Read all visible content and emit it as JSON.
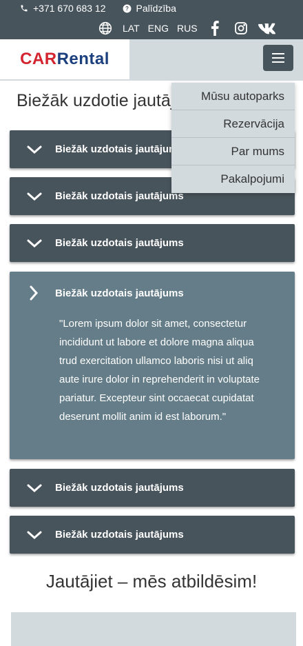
{
  "topbar": {
    "phone": "+371 670 683 12",
    "help": "Palīdzība",
    "languages": [
      "LAT",
      "ENG",
      "RUS"
    ]
  },
  "header": {
    "logo_car": "CAR",
    "logo_rental": "Rental"
  },
  "page_title": "Biežāk uzdotie jautājumi",
  "menu": {
    "items": [
      "Mūsu autoparks",
      "Rezervācija",
      "Par mums",
      "Pakalpojumi"
    ]
  },
  "faq": {
    "items": [
      {
        "question": "Biežāk uzdotais jautājums"
      },
      {
        "question": "Biežāk uzdotais jautājums"
      },
      {
        "question": "Biežāk uzdotais jautājums"
      },
      {
        "question": "Biežāk uzdotais jautājums",
        "answer": "\"Lorem ipsum dolor sit amet, consectetur\nincididunt ut labore et dolore magna aliqua\ntrud exercitation ullamco laboris nisi ut aliq\naute irure dolor in reprehenderit in voluptate\npariatur. Excepteur sint occaecat cupidatat\ndeserunt mollit anim id est laborum.\""
      },
      {
        "question": "Biežāk uzdotais jautājums"
      },
      {
        "question": "Biežāk uzdotais jautājums"
      }
    ]
  },
  "ask_title": "Jautājiet – mēs atbildēsim!",
  "colors": {
    "dark_slate": "#48545c",
    "open_panel": "#647d88",
    "light_grey": "#d2dade",
    "logo_red": "#d4242f",
    "logo_blue": "#1c3f7e"
  }
}
